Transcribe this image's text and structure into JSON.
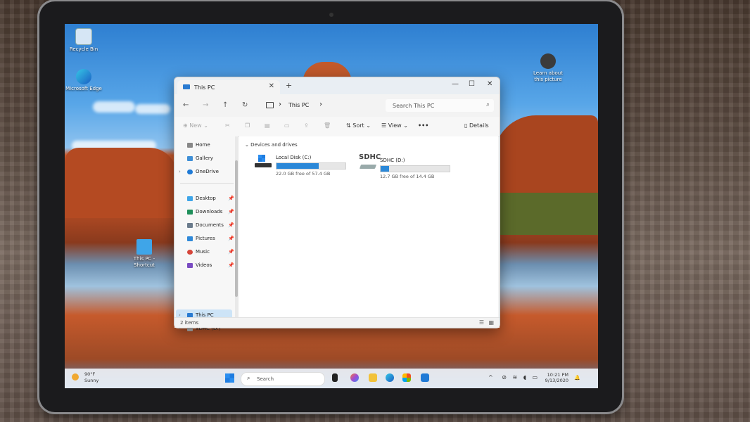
{
  "desktop": {
    "icons": [
      {
        "label": "Recycle Bin"
      },
      {
        "label": "Microsoft Edge"
      },
      {
        "label": "This PC - Shortcut"
      },
      {
        "label": "Learn about this picture"
      }
    ]
  },
  "explorer": {
    "tab_title": "This PC",
    "new_tab_glyph": "+",
    "breadcrumb": "This PC",
    "search_placeholder": "Search This PC",
    "toolbar": {
      "new_label": "New",
      "sort_label": "Sort",
      "view_label": "View",
      "more_label": "•••",
      "details_label": "Details"
    },
    "sidebar": {
      "top": [
        "Home",
        "Gallery",
        "OneDrive"
      ],
      "pinned": [
        "Desktop",
        "Downloads",
        "Documents",
        "Pictures",
        "Music",
        "Videos"
      ],
      "drives": [
        "This PC",
        "SDHC (D:)"
      ]
    },
    "section_title": "Devices and drives",
    "drives": [
      {
        "name": "Local Disk (C:)",
        "free_text": "22.0 GB free of 57.4 GB",
        "used_fraction": 0.617
      },
      {
        "name": "SDHC (D:)",
        "free_text": "12.7 GB free of 14.4 GB",
        "used_fraction": 0.118
      }
    ],
    "sdhc_logo": "SDHC",
    "status": "2 items"
  },
  "taskbar": {
    "weather_temp": "90°F",
    "weather_cond": "Sunny",
    "search_placeholder": "Search",
    "time": "10:21 PM",
    "date": "9/13/2020"
  },
  "colors": {
    "accent": "#2b88d8",
    "selection": "#cde4f7"
  }
}
